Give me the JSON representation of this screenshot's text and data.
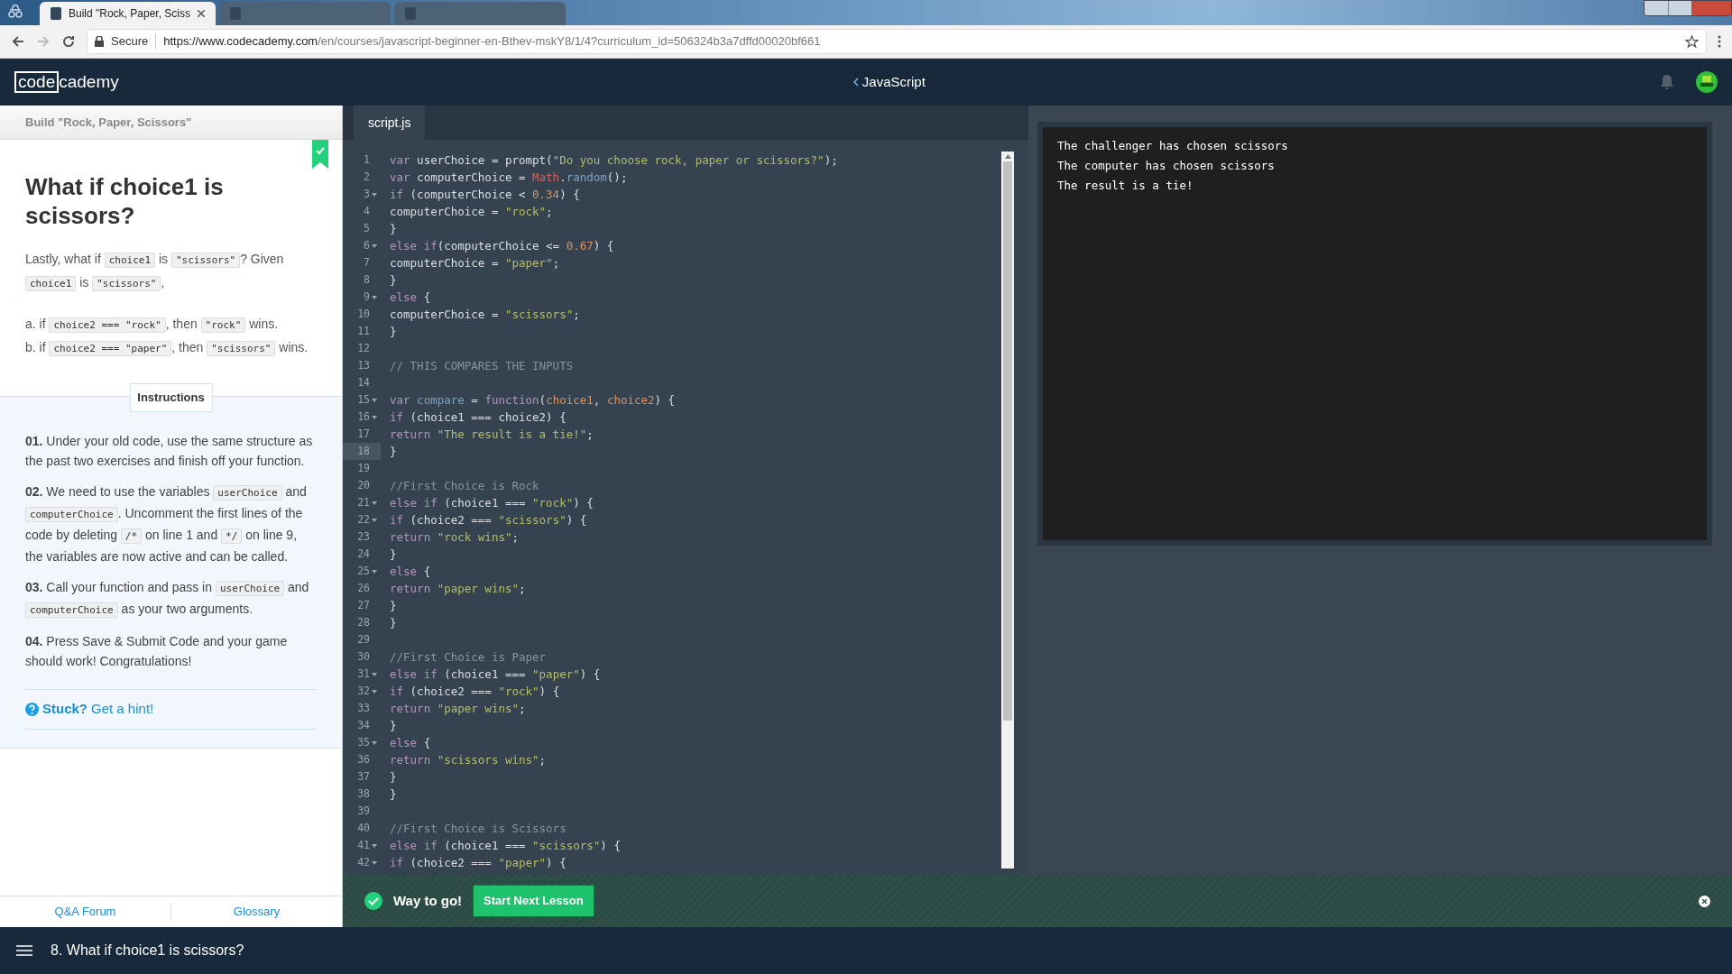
{
  "browser": {
    "tabs": [
      {
        "title": "Build \"Rock, Paper, Sciss",
        "selected": true
      },
      {
        "selected": false
      },
      {
        "selected": false
      }
    ],
    "secure_label": "Secure",
    "url_host": "https://www.codecademy.com",
    "url_path": "/en/courses/javascript-beginner-en-Bthev-mskY8/1/4?curriculum_id=506324b3a7dffd00020bf661"
  },
  "header": {
    "logo_boxed": "code",
    "logo_rest": "cademy",
    "course": "JavaScript"
  },
  "lesson": {
    "breadcrumb": "Build \"Rock, Paper, Scissors\"",
    "completed": true,
    "title": "What if choice1 is scissors?",
    "paragraphs": [
      [
        {
          "kind": "text",
          "text": "Lastly, what if "
        },
        {
          "kind": "code",
          "text": "choice1"
        },
        {
          "kind": "text",
          "text": " is "
        },
        {
          "kind": "code",
          "text": "\"scissors\""
        },
        {
          "kind": "text",
          "text": "? Given "
        },
        {
          "kind": "code",
          "text": "choice1"
        },
        {
          "kind": "text",
          "text": " is "
        },
        {
          "kind": "code",
          "text": "\"scissors\""
        },
        {
          "kind": "text",
          "text": ","
        }
      ],
      [
        {
          "kind": "text",
          "text": "a. if "
        },
        {
          "kind": "code",
          "text": "choice2 === \"rock\""
        },
        {
          "kind": "text",
          "text": ", then "
        },
        {
          "kind": "code",
          "text": "\"rock\""
        },
        {
          "kind": "text",
          "text": " wins."
        }
      ],
      [
        {
          "kind": "text",
          "text": "b. if "
        },
        {
          "kind": "code",
          "text": "choice2 === \"paper\""
        },
        {
          "kind": "text",
          "text": ", then "
        },
        {
          "kind": "code",
          "text": "\"scissors\""
        },
        {
          "kind": "text",
          "text": " wins."
        }
      ]
    ],
    "instructions_tab": "Instructions",
    "steps": [
      [
        {
          "kind": "bold",
          "text": "01."
        },
        {
          "kind": "text",
          "text": " Under your old code, use the same structure as the past two exercises and finish off your function."
        }
      ],
      [
        {
          "kind": "bold",
          "text": "02."
        },
        {
          "kind": "text",
          "text": " We need to use the variables "
        },
        {
          "kind": "code",
          "text": "userChoice"
        },
        {
          "kind": "text",
          "text": " and "
        },
        {
          "kind": "code",
          "text": "computerChoice"
        },
        {
          "kind": "text",
          "text": ". Uncomment the first lines of the code by deleting "
        },
        {
          "kind": "code",
          "text": "/*"
        },
        {
          "kind": "text",
          "text": " on line 1 and "
        },
        {
          "kind": "code",
          "text": "*/"
        },
        {
          "kind": "text",
          "text": " on line 9, the variables are now active and can be called."
        }
      ],
      [
        {
          "kind": "bold",
          "text": "03."
        },
        {
          "kind": "text",
          "text": " Call your function and pass in "
        },
        {
          "kind": "code",
          "text": "userChoice"
        },
        {
          "kind": "text",
          "text": " and "
        },
        {
          "kind": "code",
          "text": "computerChoice"
        },
        {
          "kind": "text",
          "text": " as your two arguments."
        }
      ],
      [
        {
          "kind": "bold",
          "text": "04."
        },
        {
          "kind": "text",
          "text": " Press Save & Submit Code and your game should work! Congratulations!"
        }
      ]
    ],
    "hint_label": "Stuck?",
    "hint_link": "Get a hint!",
    "footer_links": [
      "Q&A Forum",
      "Glossary"
    ]
  },
  "editor": {
    "tabs": [
      {
        "label": "script.js",
        "selected": true
      }
    ],
    "lines": [
      {
        "n": "1",
        "fold": false,
        "active": false,
        "tokens": [
          {
            "kind": "kw",
            "text": "var "
          },
          {
            "kind": "p",
            "text": "userChoice = prompt("
          },
          {
            "kind": "s",
            "text": "\"Do you choose rock, paper or scissors?\""
          },
          {
            "kind": "p",
            "text": ");"
          }
        ]
      },
      {
        "n": "2",
        "fold": false,
        "active": false,
        "tokens": [
          {
            "kind": "kw",
            "text": "var "
          },
          {
            "kind": "p",
            "text": "computerChoice = "
          },
          {
            "kind": "b",
            "text": "Math"
          },
          {
            "kind": "p",
            "text": "."
          },
          {
            "kind": "f",
            "text": "random"
          },
          {
            "kind": "p",
            "text": "();"
          }
        ]
      },
      {
        "n": "3",
        "fold": true,
        "active": false,
        "tokens": [
          {
            "kind": "kw",
            "text": "if "
          },
          {
            "kind": "p",
            "text": "(computerChoice < "
          },
          {
            "kind": "num",
            "text": "0.34"
          },
          {
            "kind": "p",
            "text": ") {"
          }
        ]
      },
      {
        "n": "4",
        "fold": false,
        "active": false,
        "tokens": [
          {
            "kind": "p",
            "text": "computerChoice = "
          },
          {
            "kind": "s",
            "text": "\"rock\""
          },
          {
            "kind": "p",
            "text": ";"
          }
        ]
      },
      {
        "n": "5",
        "fold": false,
        "active": false,
        "tokens": [
          {
            "kind": "p",
            "text": "}"
          }
        ]
      },
      {
        "n": "6",
        "fold": true,
        "active": false,
        "tokens": [
          {
            "kind": "kw",
            "text": "else if"
          },
          {
            "kind": "p",
            "text": "(computerChoice <= "
          },
          {
            "kind": "num",
            "text": "0.67"
          },
          {
            "kind": "p",
            "text": ") {"
          }
        ]
      },
      {
        "n": "7",
        "fold": false,
        "active": false,
        "tokens": [
          {
            "kind": "p",
            "text": "computerChoice = "
          },
          {
            "kind": "s",
            "text": "\"paper\""
          },
          {
            "kind": "p",
            "text": ";"
          }
        ]
      },
      {
        "n": "8",
        "fold": false,
        "active": false,
        "tokens": [
          {
            "kind": "p",
            "text": "}"
          }
        ]
      },
      {
        "n": "9",
        "fold": true,
        "active": false,
        "tokens": [
          {
            "kind": "kw",
            "text": "else "
          },
          {
            "kind": "p",
            "text": "{"
          }
        ]
      },
      {
        "n": "10",
        "fold": false,
        "active": false,
        "tokens": [
          {
            "kind": "p",
            "text": "computerChoice = "
          },
          {
            "kind": "s",
            "text": "\"scissors\""
          },
          {
            "kind": "p",
            "text": ";"
          }
        ]
      },
      {
        "n": "11",
        "fold": false,
        "active": false,
        "tokens": [
          {
            "kind": "p",
            "text": "}"
          }
        ]
      },
      {
        "n": "12",
        "fold": false,
        "active": false
      },
      {
        "n": "13",
        "fold": false,
        "active": false,
        "tokens": [
          {
            "kind": "c",
            "text": "// THIS COMPARES THE INPUTS"
          }
        ]
      },
      {
        "n": "14",
        "fold": false,
        "active": false
      },
      {
        "n": "15",
        "fold": true,
        "active": false,
        "tokens": [
          {
            "kind": "kw",
            "text": "var "
          },
          {
            "kind": "f",
            "text": "compare"
          },
          {
            "kind": "p",
            "text": " = "
          },
          {
            "kind": "kw",
            "text": "function"
          },
          {
            "kind": "p",
            "text": "("
          },
          {
            "kind": "num",
            "text": "choice1"
          },
          {
            "kind": "p",
            "text": ", "
          },
          {
            "kind": "num",
            "text": "choice2"
          },
          {
            "kind": "p",
            "text": ") {"
          }
        ]
      },
      {
        "n": "16",
        "fold": true,
        "active": false,
        "tokens": [
          {
            "kind": "kw",
            "text": "if "
          },
          {
            "kind": "p",
            "text": "(choice1 === choice2) {"
          }
        ]
      },
      {
        "n": "17",
        "fold": false,
        "active": false,
        "tokens": [
          {
            "kind": "kw",
            "text": "return "
          },
          {
            "kind": "s",
            "text": "\"The result is a tie!\""
          },
          {
            "kind": "p",
            "text": ";"
          }
        ]
      },
      {
        "n": "18",
        "fold": false,
        "active": true,
        "tokens": [
          {
            "kind": "p",
            "text": "}"
          }
        ]
      },
      {
        "n": "19",
        "fold": false,
        "active": false
      },
      {
        "n": "20",
        "fold": false,
        "active": false,
        "tokens": [
          {
            "kind": "c",
            "text": "//First Choice is Rock"
          }
        ]
      },
      {
        "n": "21",
        "fold": true,
        "active": false,
        "tokens": [
          {
            "kind": "kw",
            "text": "else if "
          },
          {
            "kind": "p",
            "text": "(choice1 === "
          },
          {
            "kind": "s",
            "text": "\"rock\""
          },
          {
            "kind": "p",
            "text": ") {"
          }
        ]
      },
      {
        "n": "22",
        "fold": true,
        "active": false,
        "tokens": [
          {
            "kind": "kw",
            "text": "if "
          },
          {
            "kind": "p",
            "text": "(choice2 === "
          },
          {
            "kind": "s",
            "text": "\"scissors\""
          },
          {
            "kind": "p",
            "text": ") {"
          }
        ]
      },
      {
        "n": "23",
        "fold": false,
        "active": false,
        "tokens": [
          {
            "kind": "kw",
            "text": "return "
          },
          {
            "kind": "s",
            "text": "\"rock wins\""
          },
          {
            "kind": "p",
            "text": ";"
          }
        ]
      },
      {
        "n": "24",
        "fold": false,
        "active": false,
        "tokens": [
          {
            "kind": "p",
            "text": "}"
          }
        ]
      },
      {
        "n": "25",
        "fold": true,
        "active": false,
        "tokens": [
          {
            "kind": "kw",
            "text": "else "
          },
          {
            "kind": "p",
            "text": "{"
          }
        ]
      },
      {
        "n": "26",
        "fold": false,
        "active": false,
        "tokens": [
          {
            "kind": "kw",
            "text": "return "
          },
          {
            "kind": "s",
            "text": "\"paper wins\""
          },
          {
            "kind": "p",
            "text": ";"
          }
        ]
      },
      {
        "n": "27",
        "fold": false,
        "active": false,
        "tokens": [
          {
            "kind": "p",
            "text": "}"
          }
        ]
      },
      {
        "n": "28",
        "fold": false,
        "active": false,
        "tokens": [
          {
            "kind": "p",
            "text": "}"
          }
        ]
      },
      {
        "n": "29",
        "fold": false,
        "active": false
      },
      {
        "n": "30",
        "fold": false,
        "active": false,
        "tokens": [
          {
            "kind": "c",
            "text": "//First Choice is Paper"
          }
        ]
      },
      {
        "n": "31",
        "fold": true,
        "active": false,
        "tokens": [
          {
            "kind": "kw",
            "text": "else if "
          },
          {
            "kind": "p",
            "text": "(choice1 === "
          },
          {
            "kind": "s",
            "text": "\"paper\""
          },
          {
            "kind": "p",
            "text": ") {"
          }
        ]
      },
      {
        "n": "32",
        "fold": true,
        "active": false,
        "tokens": [
          {
            "kind": "kw",
            "text": "if "
          },
          {
            "kind": "p",
            "text": "(choice2 === "
          },
          {
            "kind": "s",
            "text": "\"rock\""
          },
          {
            "kind": "p",
            "text": ") {"
          }
        ]
      },
      {
        "n": "33",
        "fold": false,
        "active": false,
        "tokens": [
          {
            "kind": "kw",
            "text": "return "
          },
          {
            "kind": "s",
            "text": "\"paper wins\""
          },
          {
            "kind": "p",
            "text": ";"
          }
        ]
      },
      {
        "n": "34",
        "fold": false,
        "active": false,
        "tokens": [
          {
            "kind": "p",
            "text": "}"
          }
        ]
      },
      {
        "n": "35",
        "fold": true,
        "active": false,
        "tokens": [
          {
            "kind": "kw",
            "text": "else "
          },
          {
            "kind": "p",
            "text": "{"
          }
        ]
      },
      {
        "n": "36",
        "fold": false,
        "active": false,
        "tokens": [
          {
            "kind": "kw",
            "text": "return "
          },
          {
            "kind": "s",
            "text": "\"scissors wins\""
          },
          {
            "kind": "p",
            "text": ";"
          }
        ]
      },
      {
        "n": "37",
        "fold": false,
        "active": false,
        "tokens": [
          {
            "kind": "p",
            "text": "}"
          }
        ]
      },
      {
        "n": "38",
        "fold": false,
        "active": false,
        "tokens": [
          {
            "kind": "p",
            "text": "}"
          }
        ]
      },
      {
        "n": "39",
        "fold": false,
        "active": false
      },
      {
        "n": "40",
        "fold": false,
        "active": false,
        "tokens": [
          {
            "kind": "c",
            "text": "//First Choice is Scissors"
          }
        ]
      },
      {
        "n": "41",
        "fold": true,
        "active": false,
        "tokens": [
          {
            "kind": "kw",
            "text": "else if "
          },
          {
            "kind": "p",
            "text": "(choice1 === "
          },
          {
            "kind": "s",
            "text": "\"scissors\""
          },
          {
            "kind": "p",
            "text": ") {"
          }
        ]
      },
      {
        "n": "42",
        "fold": true,
        "active": false,
        "tokens": [
          {
            "kind": "kw",
            "text": "if "
          },
          {
            "kind": "p",
            "text": "(choice2 === "
          },
          {
            "kind": "s",
            "text": "\"paper\""
          },
          {
            "kind": "p",
            "text": ") {"
          }
        ]
      }
    ]
  },
  "output": {
    "lines": [
      "The challenger has chosen scissors",
      "The computer has chosen scissors",
      "The result is a tie!"
    ]
  },
  "banner": {
    "message": "Way to go!",
    "button": "Start Next Lesson"
  },
  "bottom_bar": {
    "lesson": "8. What if choice1 is scissors?"
  }
}
